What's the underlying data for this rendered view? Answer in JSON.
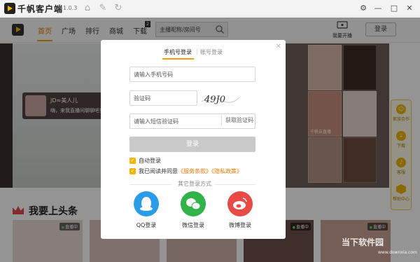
{
  "app": {
    "title": "千帆客户端",
    "version": "1.0.3"
  },
  "nav": {
    "items": [
      "首页",
      "广场",
      "排行",
      "商城",
      "下载"
    ],
    "active": "首页",
    "download_badge": "2",
    "search_placeholder": "主播昵称/房间号",
    "broadcast_label": "我要开播",
    "login_label": "登录"
  },
  "banner": {
    "anchor_name": "JD≈美人儿",
    "anchor_msg": "嗨，来我直播间聊聊吧！",
    "thumb_label": "千帆云直播"
  },
  "side": {
    "items": [
      "家族合作",
      "下载",
      "客服",
      "帮助中心"
    ]
  },
  "section": {
    "title": "我要上头条",
    "live_tag": "直播中"
  },
  "watermark": {
    "text": "当下软件园",
    "sub": "www.downxia.com"
  },
  "modal": {
    "tab_phone": "手机号登录",
    "tab_account": "账号登录",
    "phone_placeholder": "请输入手机号码",
    "captcha_placeholder": "验证码",
    "captcha_text": "49J0",
    "sms_placeholder": "请输入短信验证码",
    "get_code": "获取验证码",
    "submit": "登录",
    "auto_login": "自动登录",
    "agree_prefix": "我已阅读并同意",
    "terms": "《服务条款》",
    "privacy": "《隐私政策》",
    "other_methods": "其它登录方式",
    "social": [
      {
        "label": "QQ登录",
        "color": "#2b9de8"
      },
      {
        "label": "微信登录",
        "color": "#32b34a"
      },
      {
        "label": "微博登录",
        "color": "#e84a45"
      }
    ]
  },
  "colors": {
    "accent": "#f5a000",
    "accent_text": "#f07a00"
  }
}
